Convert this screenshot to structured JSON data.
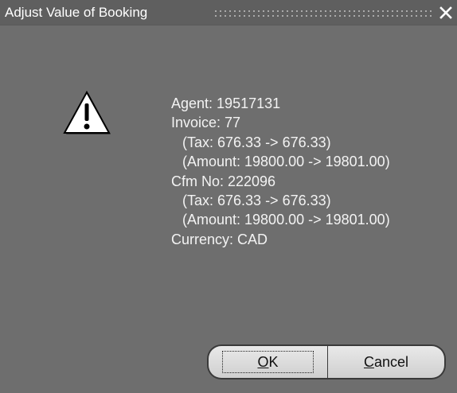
{
  "window": {
    "title": "Adjust Value of Booking",
    "close_icon": "close-icon"
  },
  "dialog": {
    "icon": "warning-icon",
    "message": {
      "agent": "Agent: 19517131",
      "invoice": "Invoice: 77",
      "invoice_tax": "(Tax: 676.33 -> 676.33)",
      "invoice_amount": "(Amount: 19800.00 -> 19801.00)",
      "cfm": "Cfm No: 222096",
      "cfm_tax": "(Tax: 676.33 -> 676.33)",
      "cfm_amount": "(Amount: 19800.00 -> 19801.00)",
      "currency": "Currency: CAD"
    }
  },
  "buttons": {
    "ok": {
      "mnemonic": "O",
      "rest": "K"
    },
    "cancel": {
      "mnemonic": "C",
      "rest": "ancel"
    }
  },
  "colors": {
    "dialog_background": "#6e6e6e",
    "titlebar_background": "#5f5f5f",
    "text": "#f3f3f3",
    "button_face": "#dcdcdc"
  }
}
